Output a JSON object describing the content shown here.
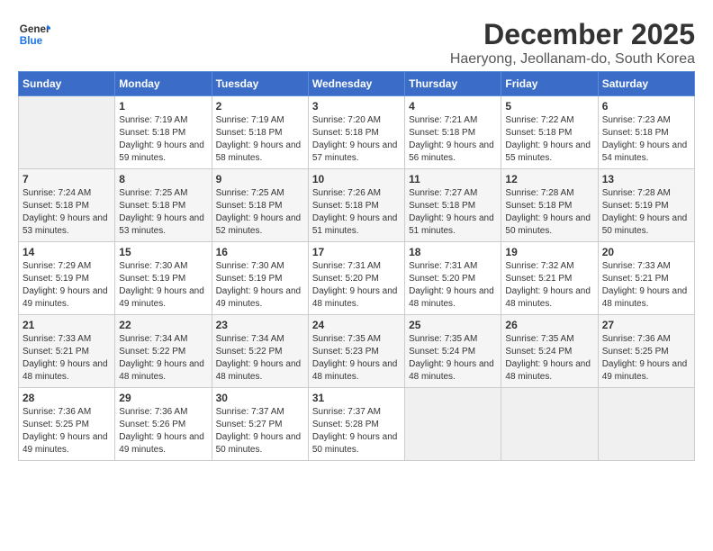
{
  "header": {
    "logo_general": "General",
    "logo_blue": "Blue",
    "month_year": "December 2025",
    "location": "Haeryong, Jeollanam-do, South Korea"
  },
  "weekdays": [
    "Sunday",
    "Monday",
    "Tuesday",
    "Wednesday",
    "Thursday",
    "Friday",
    "Saturday"
  ],
  "weeks": [
    [
      {
        "day": "",
        "empty": true
      },
      {
        "day": "1",
        "sunrise": "7:19 AM",
        "sunset": "5:18 PM",
        "daylight": "9 hours and 59 minutes."
      },
      {
        "day": "2",
        "sunrise": "7:19 AM",
        "sunset": "5:18 PM",
        "daylight": "9 hours and 58 minutes."
      },
      {
        "day": "3",
        "sunrise": "7:20 AM",
        "sunset": "5:18 PM",
        "daylight": "9 hours and 57 minutes."
      },
      {
        "day": "4",
        "sunrise": "7:21 AM",
        "sunset": "5:18 PM",
        "daylight": "9 hours and 56 minutes."
      },
      {
        "day": "5",
        "sunrise": "7:22 AM",
        "sunset": "5:18 PM",
        "daylight": "9 hours and 55 minutes."
      },
      {
        "day": "6",
        "sunrise": "7:23 AM",
        "sunset": "5:18 PM",
        "daylight": "9 hours and 54 minutes."
      }
    ],
    [
      {
        "day": "7",
        "sunrise": "7:24 AM",
        "sunset": "5:18 PM",
        "daylight": "9 hours and 53 minutes."
      },
      {
        "day": "8",
        "sunrise": "7:25 AM",
        "sunset": "5:18 PM",
        "daylight": "9 hours and 53 minutes."
      },
      {
        "day": "9",
        "sunrise": "7:25 AM",
        "sunset": "5:18 PM",
        "daylight": "9 hours and 52 minutes."
      },
      {
        "day": "10",
        "sunrise": "7:26 AM",
        "sunset": "5:18 PM",
        "daylight": "9 hours and 51 minutes."
      },
      {
        "day": "11",
        "sunrise": "7:27 AM",
        "sunset": "5:18 PM",
        "daylight": "9 hours and 51 minutes."
      },
      {
        "day": "12",
        "sunrise": "7:28 AM",
        "sunset": "5:18 PM",
        "daylight": "9 hours and 50 minutes."
      },
      {
        "day": "13",
        "sunrise": "7:28 AM",
        "sunset": "5:19 PM",
        "daylight": "9 hours and 50 minutes."
      }
    ],
    [
      {
        "day": "14",
        "sunrise": "7:29 AM",
        "sunset": "5:19 PM",
        "daylight": "9 hours and 49 minutes."
      },
      {
        "day": "15",
        "sunrise": "7:30 AM",
        "sunset": "5:19 PM",
        "daylight": "9 hours and 49 minutes."
      },
      {
        "day": "16",
        "sunrise": "7:30 AM",
        "sunset": "5:19 PM",
        "daylight": "9 hours and 49 minutes."
      },
      {
        "day": "17",
        "sunrise": "7:31 AM",
        "sunset": "5:20 PM",
        "daylight": "9 hours and 48 minutes."
      },
      {
        "day": "18",
        "sunrise": "7:31 AM",
        "sunset": "5:20 PM",
        "daylight": "9 hours and 48 minutes."
      },
      {
        "day": "19",
        "sunrise": "7:32 AM",
        "sunset": "5:21 PM",
        "daylight": "9 hours and 48 minutes."
      },
      {
        "day": "20",
        "sunrise": "7:33 AM",
        "sunset": "5:21 PM",
        "daylight": "9 hours and 48 minutes."
      }
    ],
    [
      {
        "day": "21",
        "sunrise": "7:33 AM",
        "sunset": "5:21 PM",
        "daylight": "9 hours and 48 minutes."
      },
      {
        "day": "22",
        "sunrise": "7:34 AM",
        "sunset": "5:22 PM",
        "daylight": "9 hours and 48 minutes."
      },
      {
        "day": "23",
        "sunrise": "7:34 AM",
        "sunset": "5:22 PM",
        "daylight": "9 hours and 48 minutes."
      },
      {
        "day": "24",
        "sunrise": "7:35 AM",
        "sunset": "5:23 PM",
        "daylight": "9 hours and 48 minutes."
      },
      {
        "day": "25",
        "sunrise": "7:35 AM",
        "sunset": "5:24 PM",
        "daylight": "9 hours and 48 minutes."
      },
      {
        "day": "26",
        "sunrise": "7:35 AM",
        "sunset": "5:24 PM",
        "daylight": "9 hours and 48 minutes."
      },
      {
        "day": "27",
        "sunrise": "7:36 AM",
        "sunset": "5:25 PM",
        "daylight": "9 hours and 49 minutes."
      }
    ],
    [
      {
        "day": "28",
        "sunrise": "7:36 AM",
        "sunset": "5:25 PM",
        "daylight": "9 hours and 49 minutes."
      },
      {
        "day": "29",
        "sunrise": "7:36 AM",
        "sunset": "5:26 PM",
        "daylight": "9 hours and 49 minutes."
      },
      {
        "day": "30",
        "sunrise": "7:37 AM",
        "sunset": "5:27 PM",
        "daylight": "9 hours and 50 minutes."
      },
      {
        "day": "31",
        "sunrise": "7:37 AM",
        "sunset": "5:28 PM",
        "daylight": "9 hours and 50 minutes."
      },
      {
        "day": "",
        "empty": true
      },
      {
        "day": "",
        "empty": true
      },
      {
        "day": "",
        "empty": true
      }
    ]
  ]
}
